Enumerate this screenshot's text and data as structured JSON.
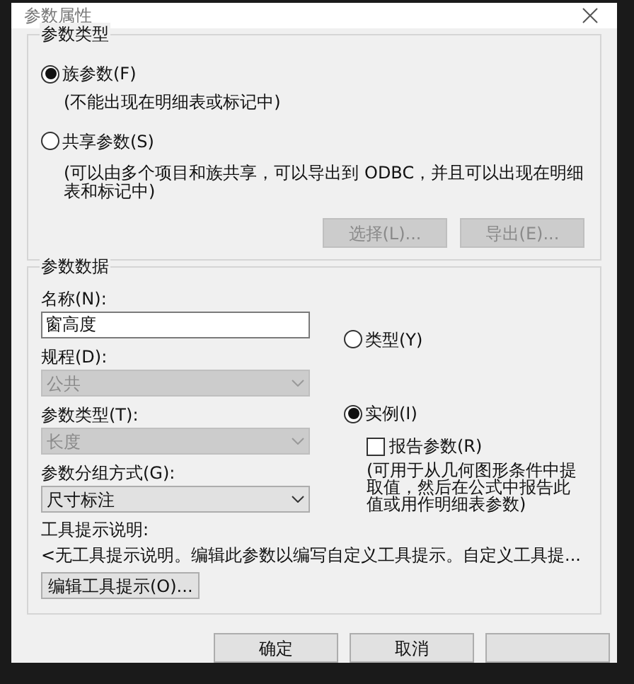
{
  "window": {
    "title": "参数属性"
  },
  "parameter_type": {
    "label": "参数类型",
    "options": [
      {
        "label": "族参数(F)",
        "note": "(不能出现在明细表或标记中)",
        "selected": true
      },
      {
        "label": "共享参数(S)",
        "note": "(可以由多个项目和族共享，可以导出到 ODBC，并且可以出现在明细表和标记中)",
        "selected": false
      }
    ],
    "buttons": [
      {
        "label": "选择(L)...",
        "disabled": true
      },
      {
        "label": "导出(E)...",
        "disabled": true
      }
    ]
  },
  "parameter_data": {
    "label": "参数数据",
    "name_label": "名称(N):",
    "name_value": "窗高度",
    "fields": [
      {
        "label": "规程(D):",
        "value": "公共",
        "disabled": true
      },
      {
        "label": "参数类型(T):",
        "value": "长度",
        "disabled": true
      },
      {
        "label": "参数分组方式(G):",
        "value": "尺寸标注",
        "disabled": false
      }
    ],
    "scope_options": [
      {
        "label": "类型(Y)",
        "selected": false
      },
      {
        "label": "实例(I)",
        "selected": true
      }
    ],
    "report": {
      "label": "报告参数(R)",
      "checked": false,
      "note": "(可用于从几何图形条件中提取值，然后在公式中报告此值或用作明细表参数)"
    },
    "tooltip_label": "工具提示说明:",
    "tooltip_text": "<无工具提示说明。编辑此参数以编写自定义工具提示。自定义工具提...",
    "edit_tooltip_button": "编辑工具提示(O)..."
  },
  "buttons": [
    "确定",
    "取消"
  ]
}
